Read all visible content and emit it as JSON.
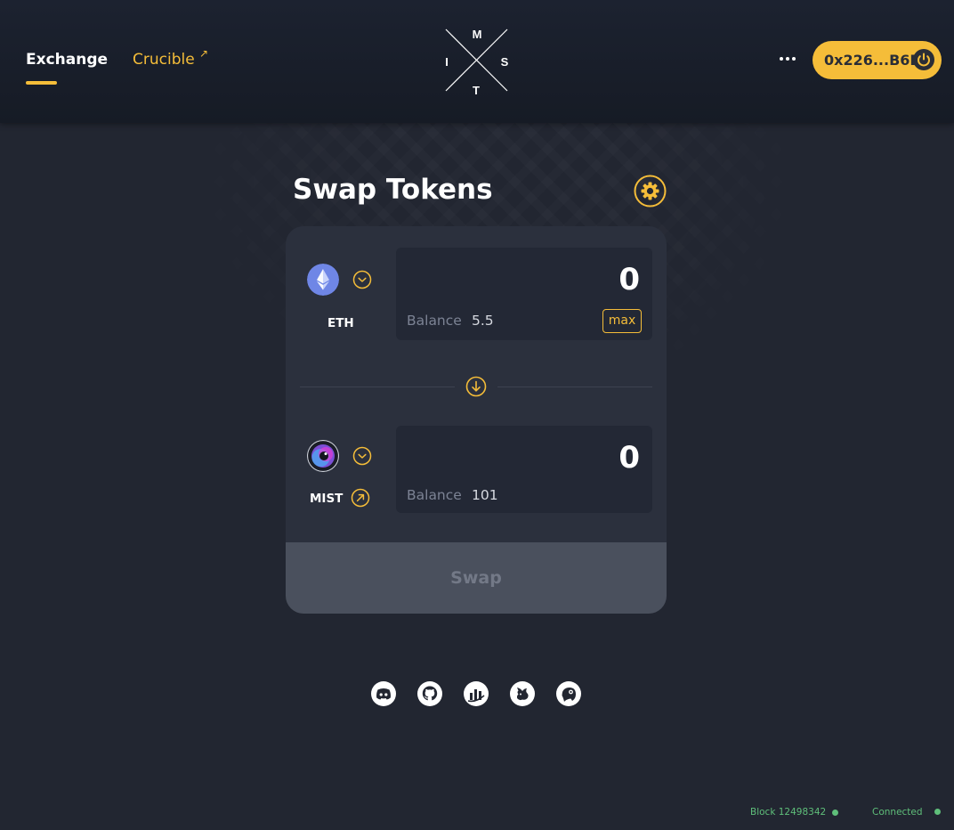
{
  "header": {
    "nav": {
      "exchange_label": "Exchange",
      "crucible_label": "Crucible",
      "crucible_external_glyph": "↗"
    },
    "logo_letters": {
      "top": "M",
      "left": "I",
      "right": "S",
      "bottom": "T"
    },
    "wallet": {
      "address": "0x226...B6E",
      "icon": "power-icon"
    },
    "more_icon": "more-horizontal-icon"
  },
  "swap": {
    "title": "Swap Tokens",
    "settings_icon": "gear-icon",
    "from": {
      "symbol": "ETH",
      "icon": "ethereum-icon",
      "amount": "0",
      "balance_label": "Balance",
      "balance_value": "5.5",
      "max_label": "max"
    },
    "switch_icon": "arrow-down-circle-icon",
    "to": {
      "symbol": "MIST",
      "icon": "mist-icon",
      "amount": "0",
      "balance_label": "Balance",
      "balance_value": "101"
    },
    "submit_label": "Swap"
  },
  "socials": [
    {
      "icon": "discord-icon"
    },
    {
      "icon": "github-icon"
    },
    {
      "icon": "chart-icon"
    },
    {
      "icon": "uniswap-icon"
    },
    {
      "icon": "coingecko-icon"
    }
  ],
  "status": {
    "block_label": "Block 12498342",
    "connection_label": "Connected"
  },
  "colors": {
    "accent": "#f5bd39",
    "background": "#222631",
    "card": "#2b303d",
    "status_ok": "#5fbf7a"
  }
}
